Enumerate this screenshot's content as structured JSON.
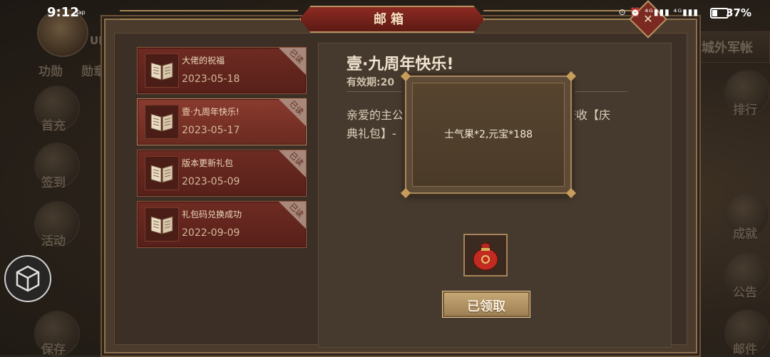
{
  "status_bar": {
    "time": "9:12",
    "tap_label": "Tap",
    "battery": "37%",
    "icons": "⊙ ⏰ ⁴ᴳ▮▮▮ ⁴ᴳ▮▮▮"
  },
  "background": {
    "uid_label": "UID",
    "left_labels": [
      "功勋",
      "勋章"
    ],
    "left_buttons": [
      "首充",
      "签到",
      "活动",
      "保存"
    ],
    "right_buttons": [
      "排行",
      "成就",
      "公告",
      "邮件"
    ],
    "camp_label": "城外军帐"
  },
  "mailbox": {
    "title": "邮箱",
    "read_tag": "已读",
    "mails": [
      {
        "subject": "大佬的祝福",
        "date": "2023-05-18"
      },
      {
        "subject": "壹·九周年快乐!",
        "date": "2023-05-17"
      },
      {
        "subject": "版本更新礼包",
        "date": "2023-05-09"
      },
      {
        "subject": "礼包码兑换成功",
        "date": "2022-09-09"
      }
    ],
    "selected_index": 1,
    "detail": {
      "title": "壹·九周年快乐!",
      "validity": "有效期:20",
      "body_line1": "亲爱的主公",
      "body_line2": "典礼包】-",
      "body_line3": "查收【庆"
    },
    "popup_text": "士气果*2,元宝*188",
    "reward_icon": "red-pouch-icon",
    "claim_label": "已领取"
  },
  "colors": {
    "accent_red": "#6e2b22",
    "gold": "#b79361",
    "panel": "#4a3b2d"
  }
}
